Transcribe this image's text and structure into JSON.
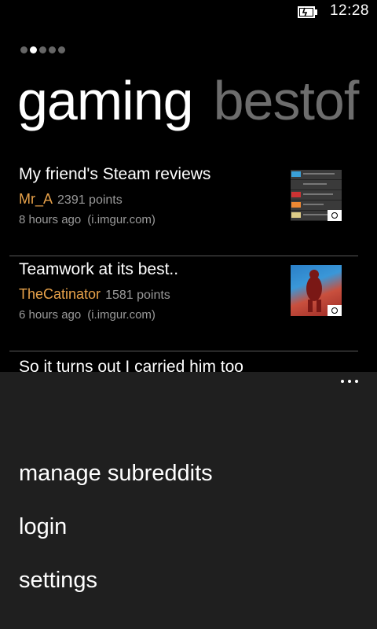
{
  "status_bar": {
    "time": "12:28"
  },
  "pivot": {
    "current": "gaming",
    "next": "bestof",
    "dot_count": 5,
    "active_dot": 1
  },
  "posts": [
    {
      "title": "My friend's Steam reviews",
      "author": "Mr_A",
      "points": "2391 points",
      "time": "8 hours ago",
      "domain": "(i.imgur.com)"
    },
    {
      "title": "Teamwork at its best..",
      "author": "TheCatinator",
      "points": "1581 points",
      "time": "6 hours ago",
      "domain": "(i.imgur.com)"
    },
    {
      "title": "So it turns out I carried him too"
    }
  ],
  "app_bar": {
    "menu": [
      "manage subreddits",
      "login",
      "settings"
    ]
  },
  "colors": {
    "accent": "#e8a24a",
    "secondary_text": "#9a9a9a",
    "app_bar_bg": "#1f1f1f"
  }
}
